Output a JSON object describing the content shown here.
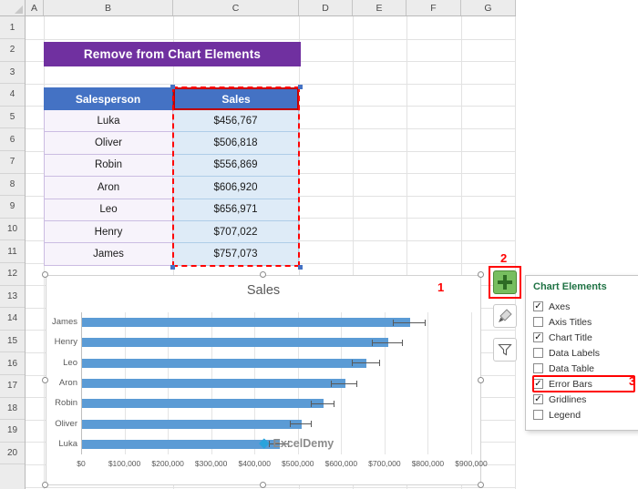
{
  "colors": {
    "banner_bg": "#7030A0",
    "table_header_bg": "#4472C4",
    "bar_color": "#5B9BD5",
    "annotation_red": "#FF0000",
    "panel_title_green": "#1F7244",
    "sales_cell_bg": "#DEEBF7",
    "salesperson_cell_bg": "#F7F3FB"
  },
  "spreadsheet": {
    "column_headers": [
      "A",
      "B",
      "C",
      "D",
      "E",
      "F",
      "G"
    ],
    "row_numbers": [
      "1",
      "2",
      "3",
      "4",
      "5",
      "6",
      "7",
      "8",
      "9",
      "10",
      "11",
      "12",
      "13",
      "14",
      "15",
      "16",
      "17",
      "18",
      "19",
      "20"
    ]
  },
  "banner": {
    "title": "Remove from Chart Elements"
  },
  "table": {
    "headers": [
      "Salesperson",
      "Sales"
    ],
    "rows": [
      [
        "Luka",
        "$456,767"
      ],
      [
        "Oliver",
        "$506,818"
      ],
      [
        "Robin",
        "$556,869"
      ],
      [
        "Aron",
        "$606,920"
      ],
      [
        "Leo",
        "$656,971"
      ],
      [
        "Henry",
        "$707,022"
      ],
      [
        "James",
        "$757,073"
      ]
    ]
  },
  "chart_data": {
    "type": "bar",
    "orientation": "horizontal",
    "title": "Sales",
    "categories": [
      "James",
      "Henry",
      "Leo",
      "Aron",
      "Robin",
      "Oliver",
      "Luka"
    ],
    "values": [
      757073,
      707022,
      656971,
      606920,
      556869,
      506818,
      456767
    ],
    "error_bars": {
      "type": "percentage",
      "value": 5
    },
    "x_tick_labels": [
      "$0",
      "$100,000",
      "$200,000",
      "$300,000",
      "$400,000",
      "$500,000",
      "$600,000",
      "$700,000",
      "$800,000",
      "$900,000"
    ],
    "xlim": [
      0,
      900000
    ],
    "gridlines": true,
    "legend": false,
    "bar_color": "#5B9BD5"
  },
  "chart_elements_panel": {
    "title": "Chart Elements",
    "items": [
      {
        "label": "Axes",
        "checked": true,
        "highlighted": false
      },
      {
        "label": "Axis Titles",
        "checked": false,
        "highlighted": false
      },
      {
        "label": "Chart Title",
        "checked": true,
        "highlighted": false
      },
      {
        "label": "Data Labels",
        "checked": false,
        "highlighted": false
      },
      {
        "label": "Data Table",
        "checked": false,
        "highlighted": false
      },
      {
        "label": "Error Bars",
        "checked": true,
        "highlighted": true
      },
      {
        "label": "Gridlines",
        "checked": true,
        "highlighted": false
      },
      {
        "label": "Legend",
        "checked": false,
        "highlighted": false
      }
    ]
  },
  "annotations": {
    "step_1": "1",
    "step_2": "2",
    "step_3": "3"
  },
  "watermark": {
    "text": "ExcelDemy"
  }
}
